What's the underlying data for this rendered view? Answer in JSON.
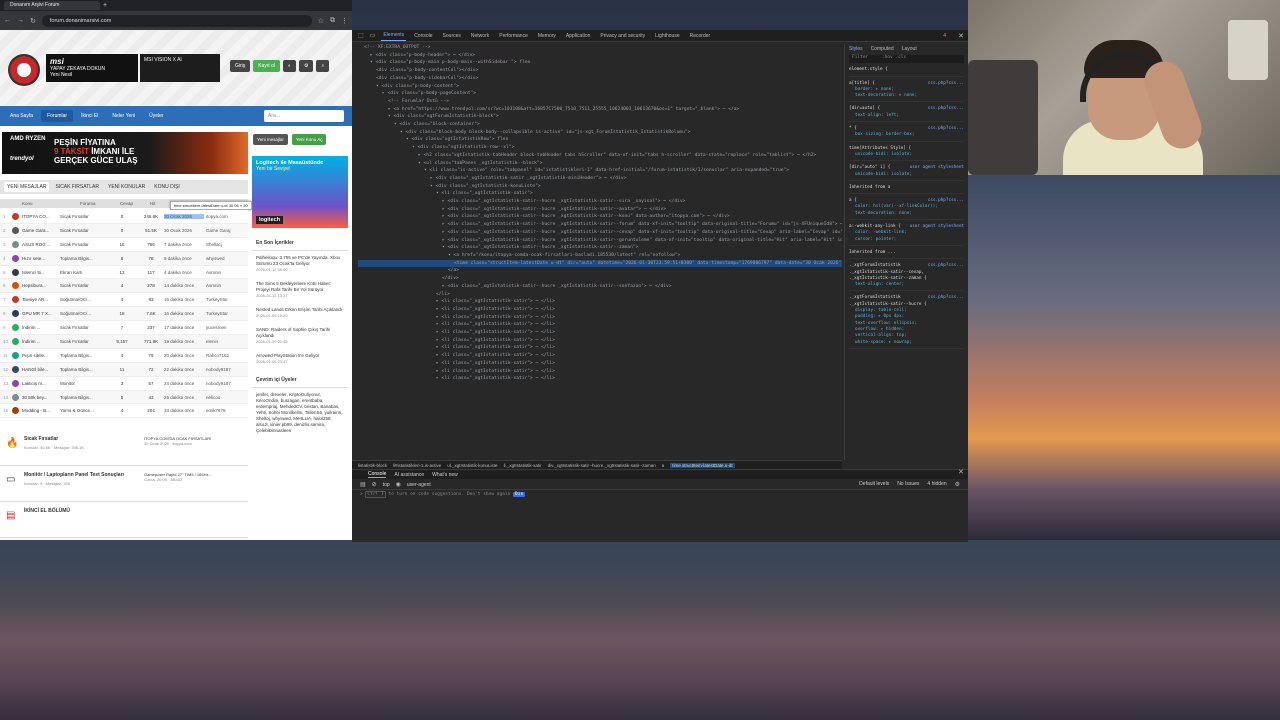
{
  "browser": {
    "tab_title": "Donanım Arşivi Forum",
    "new_tab": "+",
    "url": "forum.donanimarsivi.com",
    "colors": {
      "chrome": "#202124",
      "accent": "#2c6fb8"
    }
  },
  "site": {
    "ad_msi_brand": "msi",
    "ad_msi_text": "YAPAY ZEKAYA DOKUN",
    "ad_msi_sub": "Yeni Nesil",
    "ad_vision_text": "MSI VISION X AI",
    "login_label": "Giriş",
    "register_label": "Kayıt ol",
    "nav": [
      "Ana Sayfa",
      "Forumlar",
      "İkinci El",
      "Neler Yeni",
      "Üyeler"
    ],
    "search_placeholder": "Ara...",
    "amd_brand": "AMD RYZEN",
    "trendyol": "trendyol",
    "amd_line1": "PEŞİN FİYATINA",
    "amd_line2_red": "9 TAKSİT",
    "amd_line2": " İMKANI İLE",
    "amd_line3": "GERÇEK GÜCE ULAŞ",
    "side_btn1": "Yeni mesajlar",
    "side_btn2": "Yeni Konu Aç",
    "logi_title": "Logitech ile Masaüstünde",
    "logi_sub": "Yeni bir Seviye!",
    "logi_brand": "logitech",
    "forum_tabs": [
      "YENİ MESAJLAR",
      "SICAK FIRSATLAR",
      "YENİ KONULAR",
      "KONU DIŞI"
    ],
    "col_headers": [
      "Konu",
      "Foruma",
      "Cevap",
      "Hit"
    ],
    "tooltip": "time.structItem-latestDate.u-dt",
    "tooltip_size": "30.06 × 20",
    "threads": [
      {
        "n": "1",
        "title": "ITOPYA CO...",
        "forum": "Sicak Fırsatlar",
        "replies": "0",
        "views": "246.6K",
        "time": "30 Ocak 2026",
        "author": "itopya.com"
      },
      {
        "n": "2",
        "title": "Game Gara...",
        "forum": "Sicak Fırsatlar",
        "replies": "0",
        "views": "51.5K",
        "time": "30 Ocak 2026",
        "author": "Game Garaj"
      },
      {
        "n": "3",
        "title": "ASUS ROG ...",
        "forum": "Sicak Fırsatlar",
        "replies": "15",
        "views": "766",
        "time": "7 dakika önce",
        "author": "Shellacj"
      },
      {
        "n": "4",
        "title": "Hızır sete...",
        "forum": "Toplama Bilgis...",
        "replies": "6",
        "views": "78",
        "time": "9 dakika önce",
        "author": "whyswed"
      },
      {
        "n": "5",
        "title": "Islemci Si...",
        "forum": "Ekran Kartı",
        "replies": "12",
        "views": "117",
        "time": "4 dakika önce",
        "author": "Asmnin"
      },
      {
        "n": "6",
        "title": "Hepsibura...",
        "forum": "Sicak Fırsatlar",
        "replies": "4",
        "views": "278",
        "time": "14 dakika önce",
        "author": "Asmnin"
      },
      {
        "n": "7",
        "title": "Tavsiye AR...",
        "forum": "Soğutma/OC/...",
        "replies": "4",
        "views": "83",
        "time": "15 dakika önce",
        "author": "TurkeyStar"
      },
      {
        "n": "8",
        "title": "GPU MR 7 X...",
        "forum": "Soğutma/OC/...",
        "replies": "18",
        "views": "7.6K",
        "time": "16 dakika önce",
        "author": "TurkeyStar"
      },
      {
        "n": "9",
        "title": "İndirim ...",
        "forum": "Sicak Fırsatlar",
        "replies": "7",
        "views": "237",
        "time": "17 dakika önce",
        "author": "yucesmen"
      },
      {
        "n": "10",
        "title": "İndirim ...",
        "forum": "Sicak Fırsatlar",
        "replies": "9,157",
        "views": "771.9K",
        "time": "19 dakika önce",
        "author": "elenin"
      },
      {
        "n": "11",
        "title": "Pışın sitele...",
        "forum": "Toplama Bilgis...",
        "replies": "4",
        "views": "79",
        "time": "20 dakika önce",
        "author": "Rahco7162"
      },
      {
        "n": "12",
        "title": "HANGİ bile...",
        "forum": "Toplama Bilgis...",
        "replies": "11",
        "views": "72",
        "time": "22 dakika önce",
        "author": "nobody9187"
      },
      {
        "n": "13",
        "title": "Lakticiş m...",
        "forum": "Monitör",
        "replies": "3",
        "views": "57",
        "time": "24 dakika önce",
        "author": "nobody9187"
      },
      {
        "n": "14",
        "title": "30 50k bey...",
        "forum": "Toplama Bilgis...",
        "replies": "5",
        "views": "43",
        "time": "25 dakika önce",
        "author": "nelicoo"
      },
      {
        "n": "15",
        "title": "Modding - B...",
        "forum": "Yama & Günce...",
        "replies": "4",
        "views": "204",
        "time": "33 dakika önce",
        "author": "emik7676"
      }
    ],
    "right_head1": "En Son İçerikler",
    "news": [
      {
        "t": "Palheiloqu: 3.755 ve PC'de Yayında. Xbox Sürümü 23 Ocak'ta Geliyor",
        "d": "2026-01-12 09:00"
      },
      {
        "t": "The Sims 5 Bekleyenlere Kötü Haber: Projeyi Rafa Tarihi Bir Yol Sürüyor",
        "d": "2026-01-12 13:37"
      },
      {
        "t": "Nested Lands Erken Erişim Tarihi Açıklandı",
        "d": "2026-01-09 19:20"
      },
      {
        "t": "SAND: Raiders of Sophie Çıkış Tarihi Açıklandı",
        "d": "2026-01-09 22:35"
      },
      {
        "t": "Arrowed PlayStation 5'e Geliyor",
        "d": "2026-01-09 23:37"
      }
    ],
    "right_head2": "Çevrim içi Üyeler",
    "online_text": "jenifer, drexeler, KriptoGuliyonur, KeroOndisi, busragan, erentbaba, erdempriaj, MehdedCV, bristan, Banabas, Yehti, Sohbi Monilkelim, TallenS6, yoilrainn, Sheltoj, whyswed, MertLUA, halol258, alsoJl, vinier.pb99, denizlis.samira, ÇelebiDirinasleen",
    "sections": [
      {
        "name": "Sicak Fırsatlar",
        "meta": "Konular: 40.5K  ·  Mesajlar: 306.1K",
        "last": "ITOPYA.COM'DA OCAK FIRSATLARI",
        "last_meta": "30 Ocak 2026  ·  itopya.com"
      },
      {
        "name": "Monitör / Laptopların Panel Test Sonuçları",
        "meta": "Konular: 9  ·  Mesajlar: 165",
        "last": "Gameposer Rapid 27\" TIM5 / 165Hz...",
        "last_meta": "Cuma, 20:09  ·  AB432"
      },
      {
        "name": "İKİNCİ EL BÖLÜMÜ",
        "meta": "",
        "last": "",
        "last_meta": ""
      }
    ]
  },
  "devtools": {
    "tabs": [
      "Elements",
      "Console",
      "Sources",
      "Network",
      "Performance",
      "Memory",
      "Application",
      "Privacy and security",
      "Lighthouse",
      "Recorder"
    ],
    "active_tab": "Elements",
    "issues_badge": "4",
    "dom_lines": [
      {
        "i": 4,
        "h": "<!-- XF:EXTRA_OUTPUT -->"
      },
      {
        "i": 5,
        "h": "▸ <div class=\"p-body-header\"> ⋯ </div>"
      },
      {
        "i": 5,
        "h": "▾ <div class=\"p-body-main  p-body-main--withSidebar \"> flex"
      },
      {
        "i": 6,
        "h": "<div class=\"p-body-contentCol\"></div>"
      },
      {
        "i": 6,
        "h": "<div class=\"p-body-sidebarCol\"></div>"
      },
      {
        "i": 6,
        "h": "▾ <div class=\"p-body-content\">"
      },
      {
        "i": 7,
        "h": "▸ <div class=\"p-body-pageContent\">"
      },
      {
        "i": 8,
        "h": "<!-- Forumlar Üstü -->"
      },
      {
        "i": 8,
        "h": "▸ <a href=\"https://www.trendyol.com/sr?wc=103108&att=16857C7500_7510_7511_25555_10624003_10613670&os=1\" target=\"_blank\"> ⋯ </a>"
      },
      {
        "i": 8,
        "h": "▾ <div class=\"xgtForumIstatistik-block\">"
      },
      {
        "i": 9,
        "h": "▾ <div class=\"block-container\">"
      },
      {
        "i": 10,
        "h": "▾ <div class=\"block-body block-body--collapsible is-active\" id=\"js-xgt_ForumIstatistik_IstatistikBolumu\">"
      },
      {
        "i": 11,
        "h": "▾ <div class=\"xgtIstatistikRow\"> flex"
      },
      {
        "i": 12,
        "h": "▾ <div class=\"xgtIstatistik-row--xl\">"
      },
      {
        "i": 13,
        "h": "▸ <h2 class=\"xgtIstatistik-tabHeader block-tabHeader tabs hScroller\" data-xf-init=\"tabs h-scroller\" data-state=\"replace\" role=\"tablist\"> ⋯ </h2>"
      },
      {
        "i": 13,
        "h": "▾ <ul class=\"tabPanes _xgtIstatistik--block\">"
      },
      {
        "i": 14,
        "h": "▾ <li class=\"is-active\" role=\"tabpanel\" id=\"istatistikleri-1\" data-href-initial=\"/forum-istatistik/1/sonuclar\" aria-expanded=\"true\">"
      },
      {
        "i": 15,
        "h": "▸ <div class=\"_xgtIstatistik-satir _xgtIstatistik-miniHeader\"> ⋯ </div>"
      },
      {
        "i": 15,
        "h": "▾ <div class=\"_xgtIstatistik-konuListe\">"
      },
      {
        "i": 16,
        "h": "▾ <li class=\"_xgtIstatistik-satir\">"
      },
      {
        "i": 17,
        "h": "▸ <div class=\"_xgtIstatistik-satir--hucre _xgtIstatistik-satir--sira _sayisal\"> ⋯ </div>"
      },
      {
        "i": 17,
        "h": "▸ <div class=\"_xgtIstatistik-satir--hucre _xgtIstatistik-satir--avatar\"> ⋯ </div>"
      },
      {
        "i": 17,
        "h": "▸ <div class=\"_xgtIstatistik-satir--hucre _xgtIstatistik-satir--konu\" data-author=\"itopya.com\"> ⋯ </div>"
      },
      {
        "i": 17,
        "h": "▸ <div class=\"_xgtIstatistik-satir--hucre _xgtIstatistik-satir--forum\" data-xf-init=\"tooltip\" data-original-title=\"Forumu\" id=\"js-XFUniqueId8\"> ⋯ </div>"
      },
      {
        "i": 17,
        "h": "▸ <div class=\"_xgtIstatistik-satir--hucre _xgtIstatistik-satir--cevap\" data-xf-init=\"tooltip\" data-original-title=\"Cevap\" aria-label=\"Cevap\" id=\"js-XFUniqueId9\"> 0 </div>"
      },
      {
        "i": 17,
        "h": "▸ <div class=\"_xgtIstatistik-satir--hucre _xgtIstatistik-satir--goruntuleme\" data-xf-init=\"tooltip\" data-original-title=\"Hit\" aria-label=\"Hit\" id=\"js-XFUniqueId10\"> 246.6K </div>"
      },
      {
        "i": 17,
        "h": "▾ <div class=\"_xgtIstatistik-satir--hucre _xgtIstatistik-satir--zaman\">"
      },
      {
        "i": 18,
        "h": "▾ <a href=\"/konu/itopya-comda-ocak-firsatlari-basladi.185530/latest\" rel=\"nofollow\">"
      },
      {
        "i": 19,
        "h": "<time class=\"structItem-latestDate u-dt\" dir=\"auto\" datetime=\"2026-01-30T23:59:51+0300\" data-timestamp=\"1769806797\" data-date=\"30 Ocak 2026\" data-time=\"23:59\" data-short=\"24dkw\" title=\"30 Ocak 2026, 23:59\">30 Ocak 2026</time> == $0",
        "sel": true
      },
      {
        "i": 18,
        "h": "</a>"
      },
      {
        "i": 17,
        "h": "</div>"
      },
      {
        "i": 17,
        "h": "▸ <div class=\"_xgtIstatistik-satir--hucre _xgtIstatistik-satir--sonYazan\"> ⋯ </div>"
      },
      {
        "i": 16,
        "h": "</li>"
      },
      {
        "i": 16,
        "h": "▸ <li class=\"_xgtIstatistik-satir\"> ⋯ </li>"
      },
      {
        "i": 16,
        "h": "▸ <li class=\"_xgtIstatistik-satir\"> ⋯ </li>"
      },
      {
        "i": 16,
        "h": "▸ <li class=\"_xgtIstatistik-satir\"> ⋯ </li>"
      },
      {
        "i": 16,
        "h": "▸ <li class=\"_xgtIstatistik-satir\"> ⋯ </li>"
      },
      {
        "i": 16,
        "h": "▸ <li class=\"_xgtIstatistik-satir\"> ⋯ </li>"
      },
      {
        "i": 16,
        "h": "▸ <li class=\"_xgtIstatistik-satir\"> ⋯ </li>"
      },
      {
        "i": 16,
        "h": "▸ <li class=\"_xgtIstatistik-satir\"> ⋯ </li>"
      },
      {
        "i": 16,
        "h": "▸ <li class=\"_xgtIstatistik-satir\"> ⋯ </li>"
      },
      {
        "i": 16,
        "h": "▸ <li class=\"_xgtIstatistik-satir\"> ⋯ </li>"
      },
      {
        "i": 16,
        "h": "▸ <li class=\"_xgtIstatistik-satir\"> ⋯ </li>"
      },
      {
        "i": 16,
        "h": "▸ <li class=\"_xgtIstatistik-satir\"> ⋯ </li>"
      }
    ],
    "styles_tabs": [
      "Styles",
      "Computed",
      "Layout"
    ],
    "filter_placeholder": "Filter",
    "filter_right": ":hov .cls",
    "rules": [
      {
        "sel": "element.style {",
        "props": [],
        "src": ""
      },
      {
        "sel": "a[title] {",
        "props": [
          "border: ▸ none;",
          "text-decoration: ▸ none;"
        ],
        "src": "css.php?css..."
      },
      {
        "sel": "[dir=auto] {",
        "props": [
          "text-align: left;"
        ],
        "src": "css.php?css..."
      },
      {
        "sel": "* {",
        "props": [
          "box-sizing: border-box;"
        ],
        "src": "css.php?css..."
      },
      {
        "sel": "time[Attributes Style] {",
        "props": [
          "unicode-bidi: isolate;"
        ],
        "src": ""
      },
      {
        "sel": "[dir=\"auto\" i] {",
        "props": [
          "unicode-bidi: isolate;"
        ],
        "src": "user agent stylesheet"
      },
      {
        "sel": "Inherited from a",
        "props": [],
        "src": ""
      },
      {
        "sel": "a {",
        "props": [
          "color: hsl(var(--xf-linkColor));",
          "text-decoration: none;"
        ],
        "src": "css.php?css..."
      },
      {
        "sel": "a:-webkit-any-link {",
        "props": [
          "color: -webkit-link;",
          "cursor: pointer;"
        ],
        "src": "user agent stylesheet"
      },
      {
        "sel": "Inherited from ...",
        "props": [],
        "src": ""
      },
      {
        "sel": "._xgtForumIstatistik ._xgtIstatistik-satir--cevap, ._xgtIstatistik-satir--zaman {",
        "props": [
          "text-align: center;"
        ],
        "src": "css.php?css..."
      },
      {
        "sel": "._xgtForumIstatistik ._xgtIstatistik-satir--hucre {",
        "props": [
          "display: table-cell;",
          "padding: ▸ 0px 4px;",
          "text-overflow: ellipsis;",
          "overflow: ▸ hidden;",
          "vertical-align: top;",
          "white-space: ▸ nowrap;"
        ],
        "src": "css.php?css..."
      }
    ],
    "crumbs": [
      "listatistik-block",
      "li#istatistikleri-1.is-active",
      "ul._xgtIstatistik-konuListe",
      "li._xgtIstatistik-satir",
      "div._xgtIstatistik-satir--hucre._xgtIstatistik-satir--zaman",
      "a",
      "time.structItem-latestDate.u-dt"
    ],
    "drawer_tabs": [
      "Console",
      "AI assistance",
      "What's new"
    ],
    "console_context": "top",
    "console_filter": "user-agent",
    "default_levels": "Default levels",
    "no_issues": "No Issues",
    "hidden_count": "4 hidden",
    "console_hint_pre": "Ctrl I",
    "console_hint": " to turn on code suggestions. Don't show again ",
    "console_hint_badge": "Dis"
  }
}
